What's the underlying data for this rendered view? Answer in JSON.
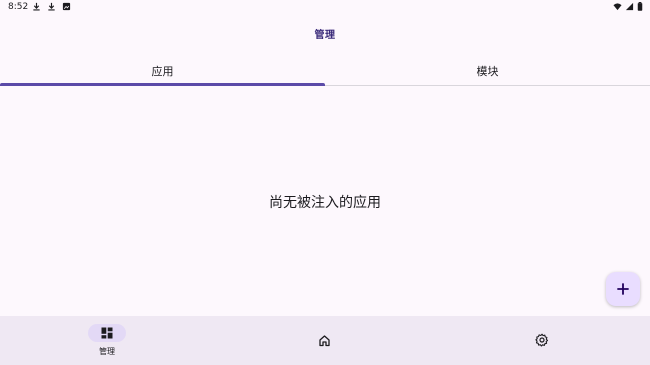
{
  "status_bar": {
    "time": "8:52",
    "left_icons": [
      "download-icon",
      "download-icon",
      "image-icon"
    ],
    "right_icons": [
      "wifi-icon",
      "signal-icon",
      "battery-icon"
    ]
  },
  "app": {
    "title": "管理"
  },
  "tabs": [
    {
      "label": "应用",
      "selected": true
    },
    {
      "label": "模块",
      "selected": false
    }
  ],
  "main": {
    "empty_message": "尚无被注入的应用"
  },
  "fab": {
    "icon": "add-icon"
  },
  "bottom_nav": {
    "items": [
      {
        "label": "管理",
        "icon": "dashboard-icon",
        "selected": true
      },
      {
        "label": "",
        "icon": "home-icon",
        "selected": false
      },
      {
        "label": "",
        "icon": "settings-icon",
        "selected": false
      }
    ]
  },
  "colors": {
    "accent": "#5b4aa8",
    "background": "#fdf8fd",
    "nav_background": "#efe8f3",
    "fab_background": "#e9ddff"
  }
}
